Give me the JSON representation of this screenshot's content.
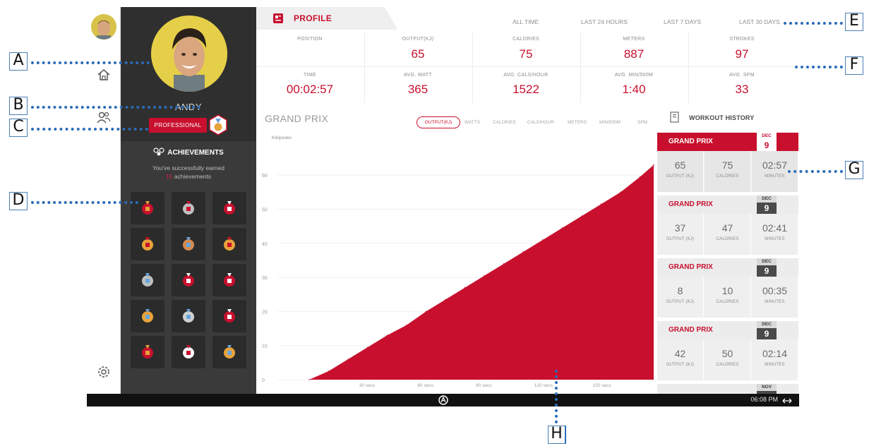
{
  "callouts": {
    "A": "A",
    "B": "B",
    "C": "C",
    "D": "D",
    "E": "E",
    "F": "F",
    "G": "G",
    "H": "H"
  },
  "profile": {
    "tab_label": "PROFILE",
    "username": "ANDY",
    "level": "PROFESSIONAL"
  },
  "time_filters": [
    "ALL TIME",
    "LAST 24 HOURS",
    "LAST 7 DAYS",
    "LAST 30 DAYS"
  ],
  "stats": [
    {
      "label": "POSITION",
      "value": ""
    },
    {
      "label": "OUTPUT(KJ)",
      "value": "65"
    },
    {
      "label": "CALORIES",
      "value": "75"
    },
    {
      "label": "METERS",
      "value": "887"
    },
    {
      "label": "STROKES",
      "value": "97"
    },
    {
      "label": "TIME",
      "value": "00:02:57"
    },
    {
      "label": "AVG. WATT",
      "value": "365"
    },
    {
      "label": "AVG. CALS/HOUR",
      "value": "1522"
    },
    {
      "label": "AVG. MIN/500M",
      "value": "1:40"
    },
    {
      "label": "AVG. SPM",
      "value": "33"
    }
  ],
  "achievements": {
    "title": "ACHIEVEMENTS",
    "subtitle_pre": "You've successfully earned",
    "subtitle_count": "15",
    "subtitle_post": "achievements",
    "icons": [
      "first-aid-badge-icon",
      "rocket-icon",
      "two-sessions-icon",
      "gold-medal-1-icon",
      "bronze-medal-icon",
      "trophies-icon",
      "silver-medal-2-icon",
      "three-sessions-icon",
      "five-sessions-icon",
      "speed-gauge-icon",
      "silver-medal-icon",
      "ten-sessions-icon",
      "flame-icon",
      "fifty-card-icon",
      "gold-medal-icon"
    ]
  },
  "chart_tabs": {
    "active": "OUTPUT(KJ)",
    "others": [
      "WATTS",
      "CALORIES",
      "CALS/HOUR",
      "METERS",
      "MIN/500M",
      "SPM"
    ]
  },
  "chart_data": {
    "type": "area",
    "title": "GRAND PRIX",
    "ylabel": "Kilojoules",
    "xlabel": "",
    "x_ticks": [
      "30 secs",
      "60 secs",
      "90 secs",
      "120 secs",
      "150 secs"
    ],
    "y_ticks": [
      0,
      10,
      20,
      30,
      40,
      50,
      60
    ],
    "ylim": [
      0,
      65
    ],
    "xlim": [
      0,
      177
    ],
    "grid": true,
    "series": [
      {
        "name": "",
        "color": "#c8102e",
        "x": [
          0,
          10,
          20,
          30,
          40,
          50,
          60,
          70,
          80,
          90,
          100,
          110,
          120,
          130,
          140,
          150,
          160,
          170,
          177
        ],
        "values": [
          0,
          2.5,
          6,
          9.5,
          13,
          16,
          20,
          23.5,
          27,
          30.5,
          34,
          37.5,
          41,
          44.5,
          48,
          51.5,
          55,
          59.5,
          63
        ]
      }
    ]
  },
  "workout_history": {
    "title": "WORKOUT HISTORY",
    "items": [
      {
        "name": "GRAND PRIX",
        "month": "DEC",
        "day": "9",
        "output": "65",
        "output_label": "OUTPUT (KJ)",
        "calories": "75",
        "calories_label": "CALORIES",
        "minutes": "02:57",
        "minutes_label": "MINUTES"
      },
      {
        "name": "GRAND PRIX",
        "month": "DEC",
        "day": "9",
        "output": "37",
        "output_label": "OUTPUT (KJ)",
        "calories": "47",
        "calories_label": "CALORIES",
        "minutes": "02:41",
        "minutes_label": "MINUTES"
      },
      {
        "name": "GRAND PRIX",
        "month": "DEC",
        "day": "9",
        "output": "8",
        "output_label": "OUTPUT (KJ)",
        "calories": "10",
        "calories_label": "CALORIES",
        "minutes": "00:35",
        "minutes_label": "MINUTES"
      },
      {
        "name": "GRAND PRIX",
        "month": "DEC",
        "day": "9",
        "output": "42",
        "output_label": "OUTPUT (KJ)",
        "calories": "50",
        "calories_label": "CALORIES",
        "minutes": "02:14",
        "minutes_label": "MINUTES"
      },
      {
        "name": "",
        "month": "NOV",
        "day": "",
        "output": "",
        "output_label": "",
        "calories": "",
        "calories_label": "",
        "minutes": "",
        "minutes_label": ""
      }
    ]
  },
  "status_bar": {
    "clock": "06:08 PM"
  },
  "colors": {
    "accent": "#c8102e",
    "sidebar": "#3a3a3a",
    "sidebar_dark": "#2f2f2f",
    "callout_line": "#2b6cb8"
  }
}
